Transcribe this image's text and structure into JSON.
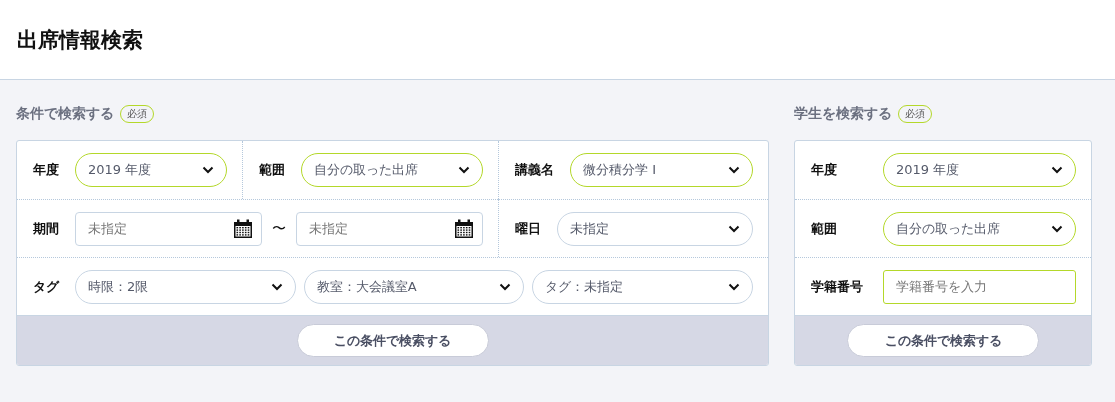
{
  "page_title": "出席情報検索",
  "condition_search": {
    "title": "条件で検索する",
    "badge": "必須",
    "button": "この条件で検索する",
    "rows": [
      [
        {
          "kind": "select",
          "label": "年度",
          "value": "2019 年度",
          "highlighted": true
        },
        {
          "kind": "select",
          "label": "範囲",
          "value": "自分の取った出席",
          "highlighted": true
        },
        {
          "kind": "select",
          "label": "講義名",
          "value": "微分積分学 I",
          "highlighted": true
        }
      ],
      [
        {
          "kind": "date_range",
          "colspan": 2,
          "label": "期間",
          "from_placeholder": "未指定",
          "separator": "〜",
          "to_placeholder": "未指定"
        },
        {
          "kind": "select",
          "label": "曜日",
          "value": "未指定",
          "highlighted": false
        }
      ],
      [
        {
          "kind": "tags",
          "colspan": 3,
          "label": "タグ",
          "selects": [
            {
              "value": "時限：2限",
              "highlighted": false
            },
            {
              "value": "教室：大会議室A",
              "highlighted": false
            },
            {
              "value": "タグ：未指定",
              "highlighted": false
            }
          ]
        }
      ]
    ]
  },
  "student_search": {
    "title": "学生を検索する",
    "badge": "必須",
    "button": "この条件で検索する",
    "rows": [
      {
        "kind": "select",
        "label": "年度",
        "value": "2019 年度",
        "highlighted": true
      },
      {
        "kind": "select",
        "label": "範囲",
        "value": "自分の取った出席",
        "highlighted": true
      },
      {
        "kind": "input",
        "label": "学籍番号",
        "placeholder": "学籍番号を入力",
        "highlighted": true
      }
    ]
  }
}
